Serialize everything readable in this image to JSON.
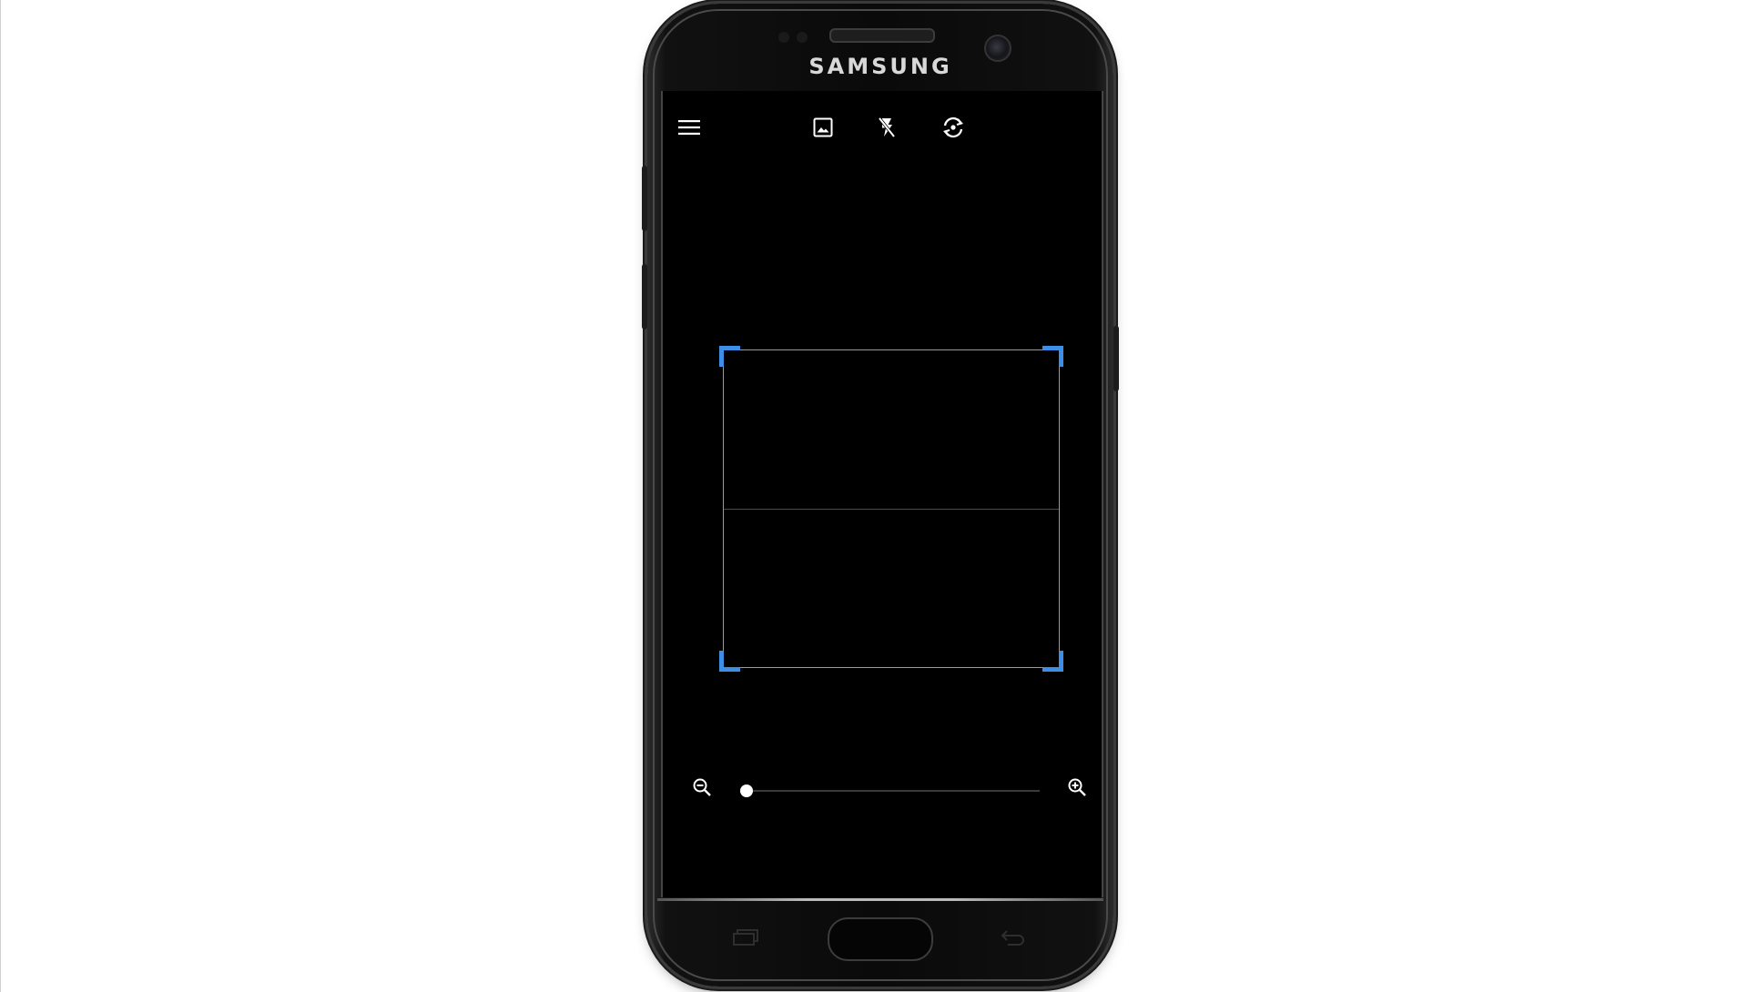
{
  "device": {
    "brand": "SAMSUNG"
  },
  "toolbar": {
    "icons": [
      "menu-icon",
      "gallery-icon",
      "flash-off-icon",
      "switch-camera-icon"
    ]
  },
  "scanner": {
    "frame_color": "#9a9a9a",
    "corner_color": "#3d8ee6",
    "scan_line_color": "#b0202a"
  },
  "zoom": {
    "level": 0,
    "min_icon": "zoom-out-icon",
    "max_icon": "zoom-in-icon"
  },
  "nav": {
    "icons": [
      "recent-apps-icon",
      "home-button",
      "back-icon"
    ]
  }
}
